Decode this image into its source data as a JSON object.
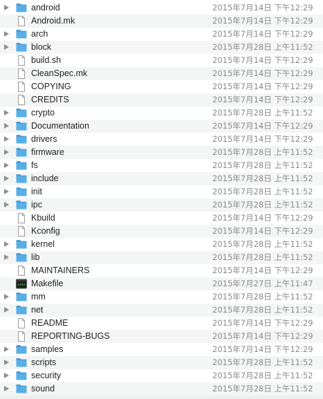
{
  "rows": [
    {
      "name": "android",
      "type": "folder",
      "date": "2015年7月14日 下午12:29"
    },
    {
      "name": "Android.mk",
      "type": "file",
      "date": "2015年7月14日 下午12:29"
    },
    {
      "name": "arch",
      "type": "folder",
      "date": "2015年7月14日 下午12:29"
    },
    {
      "name": "block",
      "type": "folder",
      "date": "2015年7月28日 上午11:52"
    },
    {
      "name": "build.sh",
      "type": "file",
      "date": "2015年7月14日 下午12:29"
    },
    {
      "name": "CleanSpec.mk",
      "type": "file",
      "date": "2015年7月14日 下午12:29"
    },
    {
      "name": "COPYING",
      "type": "file",
      "date": "2015年7月14日 下午12:29"
    },
    {
      "name": "CREDITS",
      "type": "file",
      "date": "2015年7月14日 下午12:29"
    },
    {
      "name": "crypto",
      "type": "folder",
      "date": "2015年7月28日 上午11:52"
    },
    {
      "name": "Documentation",
      "type": "folder",
      "date": "2015年7月14日 下午12:29"
    },
    {
      "name": "drivers",
      "type": "folder",
      "date": "2015年7月14日 下午12:29"
    },
    {
      "name": "firmware",
      "type": "folder",
      "date": "2015年7月28日 上午11:52"
    },
    {
      "name": "fs",
      "type": "folder",
      "date": "2015年7月28日 上午11:52"
    },
    {
      "name": "include",
      "type": "folder",
      "date": "2015年7月28日 上午11:52"
    },
    {
      "name": "init",
      "type": "folder",
      "date": "2015年7月28日 上午11:52"
    },
    {
      "name": "ipc",
      "type": "folder",
      "date": "2015年7月28日 上午11:52"
    },
    {
      "name": "Kbuild",
      "type": "file",
      "date": "2015年7月14日 下午12:29"
    },
    {
      "name": "Kconfig",
      "type": "file",
      "date": "2015年7月14日 下午12:29"
    },
    {
      "name": "kernel",
      "type": "folder",
      "date": "2015年7月28日 上午11:52"
    },
    {
      "name": "lib",
      "type": "folder",
      "date": "2015年7月28日 上午11:52"
    },
    {
      "name": "MAINTAINERS",
      "type": "file",
      "date": "2015年7月14日 下午12:29"
    },
    {
      "name": "Makefile",
      "type": "exec",
      "date": "2015年7月27日 上午11:47"
    },
    {
      "name": "mm",
      "type": "folder",
      "date": "2015年7月28日 上午11:52"
    },
    {
      "name": "net",
      "type": "folder",
      "date": "2015年7月28日 上午11:52"
    },
    {
      "name": "README",
      "type": "file",
      "date": "2015年7月14日 下午12:29"
    },
    {
      "name": "REPORTING-BUGS",
      "type": "file",
      "date": "2015年7月14日 下午12:29"
    },
    {
      "name": "samples",
      "type": "folder",
      "date": "2015年7月14日 下午12:29"
    },
    {
      "name": "scripts",
      "type": "folder",
      "date": "2015年7月28日 上午11:52"
    },
    {
      "name": "security",
      "type": "folder",
      "date": "2015年7月28日 上午11:52"
    },
    {
      "name": "sound",
      "type": "folder",
      "date": "2015年7月28日 上午11:52"
    }
  ],
  "colors": {
    "folder": "#5aaee6",
    "folder_tab": "#4a9bd6",
    "disclosure": "#8e8e8e",
    "date_text": "#8a8a8a",
    "alt_row": "#f4f5f5"
  },
  "icons": {
    "folder": "folder-icon",
    "file": "document-icon",
    "exec": "terminal-executable-icon",
    "disclosure": "disclosure-triangle-icon"
  }
}
